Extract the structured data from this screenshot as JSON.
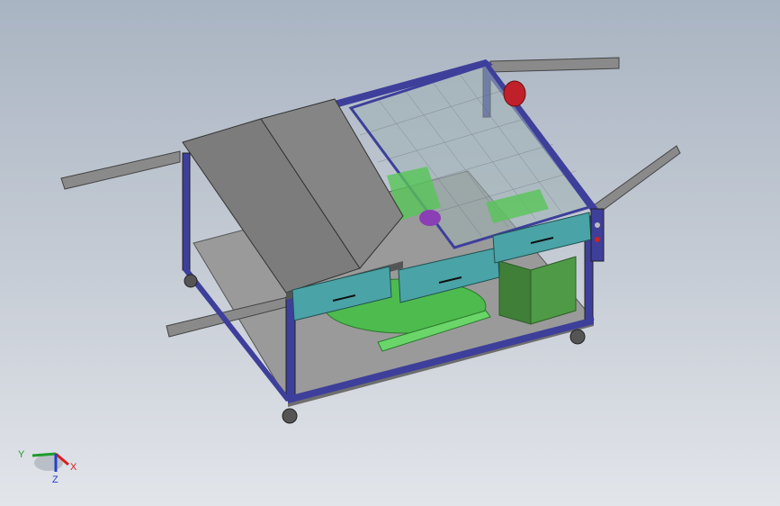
{
  "viewport": {
    "background_top": "#a9b4c2",
    "background_bottom": "#e2e5ea"
  },
  "model": {
    "frame_color": "#3d3f9a",
    "top_panel_color": "#7c7c7c",
    "drawer_color": "#4aa3a6",
    "mesh_color": "#5e8f8c",
    "green_part_color": "#58c558",
    "motor_color": "#c0202a",
    "box_color": "#4f9a46"
  },
  "triad": {
    "x_label": "X",
    "y_label": "Y",
    "z_label": "Z",
    "x_color": "#d81f1f",
    "y_color": "#1f9c2b",
    "z_color": "#2440c8"
  }
}
